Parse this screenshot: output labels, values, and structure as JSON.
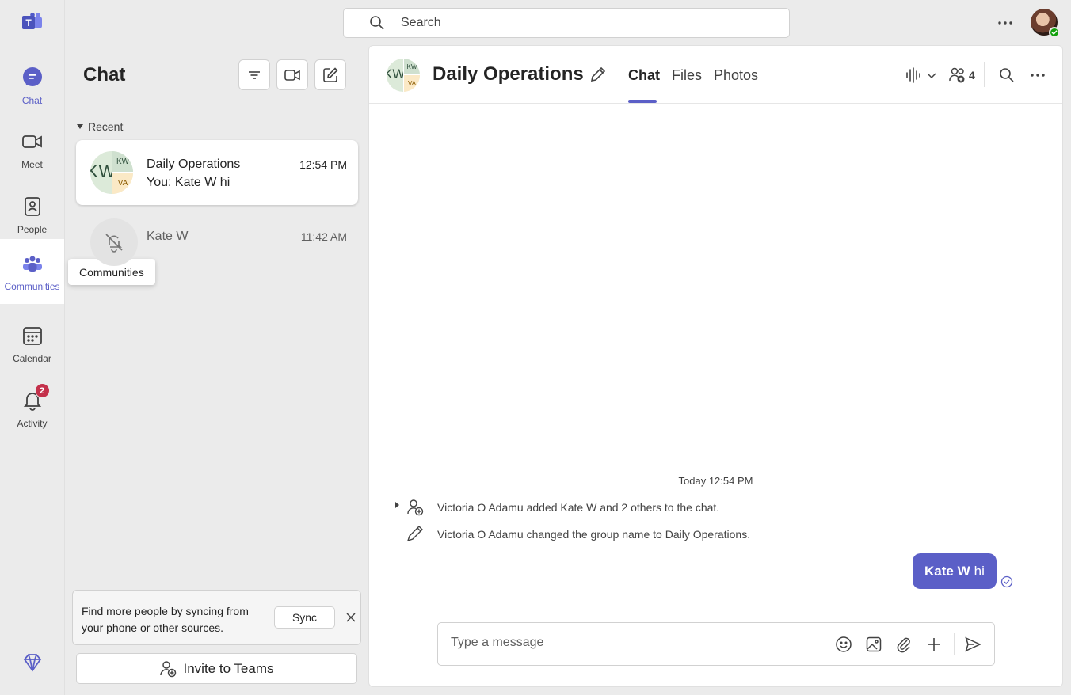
{
  "app": {
    "brand_color": "#5b5fc7",
    "icon": "teams-logo-icon"
  },
  "rail": {
    "items": [
      {
        "label": "Chat",
        "icon": "chat-icon",
        "active": true
      },
      {
        "label": "Meet",
        "icon": "video-camera-icon"
      },
      {
        "label": "People",
        "icon": "contacts-book-icon"
      },
      {
        "label": "Communities",
        "icon": "communities-icon",
        "hover": true
      },
      {
        "label": "Calendar",
        "icon": "calendar-icon"
      },
      {
        "label": "Activity",
        "icon": "bell-icon",
        "badge": "2"
      }
    ],
    "tooltip": "Communities",
    "premium_icon": "diamond-icon"
  },
  "topbar": {
    "search_placeholder": "Search",
    "more_icon": "more-horizontal-icon"
  },
  "list": {
    "title": "Chat",
    "section": "Recent",
    "chats": [
      {
        "name": "Daily Operations",
        "preview": "You: Kate W hi",
        "time": "12:54 PM",
        "avatar_initials": "KW",
        "avatar_initials_2": "VA",
        "selected": true
      },
      {
        "name": "Kate W",
        "time": "11:42 AM",
        "icon": "bell-off-icon",
        "muted": true
      }
    ],
    "sync_card": {
      "text": "Find more people by syncing from your phone or other sources.",
      "button": "Sync"
    },
    "invite_label": "Invite to Teams"
  },
  "conversation": {
    "title": "Daily Operations",
    "avatar_initials": "KW",
    "avatar_initials_2": "VA",
    "tabs": [
      "Chat",
      "Files",
      "Photos"
    ],
    "participants_count": "4",
    "timestamp": "Today 12:54 PM",
    "events": [
      "Victoria O Adamu added Kate W and 2 others to the chat.",
      "Victoria O Adamu changed the group name to Daily Operations."
    ],
    "message": {
      "mention": "Kate W",
      "text": "hi"
    },
    "composer_placeholder": "Type a message"
  }
}
